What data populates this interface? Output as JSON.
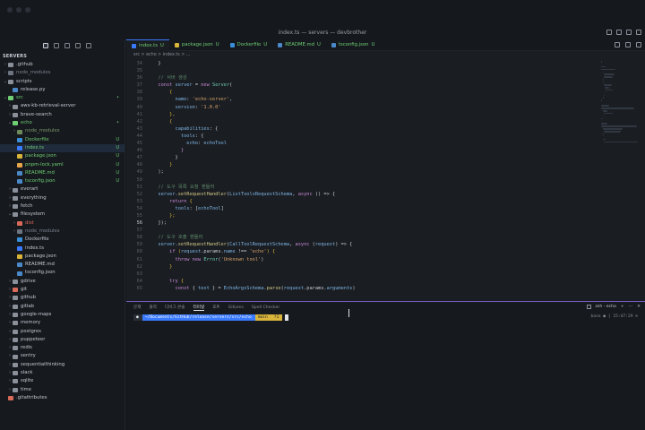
{
  "window": {
    "title": "index.ts — servers — devbrother"
  },
  "sidebar": {
    "title": "SERVERS",
    "items": [
      {
        "label": ".github",
        "indent": 1,
        "type": "folder",
        "open": false,
        "color": "#c6cbd3",
        "icon_color": "#8a9099"
      },
      {
        "label": "node_modules",
        "indent": 1,
        "type": "folder",
        "open": false,
        "color": "#7d8590",
        "icon_color": "#6d7580"
      },
      {
        "label": "scripts",
        "indent": 1,
        "type": "folder",
        "open": true,
        "color": "#c6cbd3",
        "icon_color": "#8a9099"
      },
      {
        "label": "release.py",
        "indent": 2,
        "type": "file",
        "color": "#c6cbd3",
        "icon_color": "#4a88c7"
      },
      {
        "label": "src",
        "indent": 1,
        "type": "folder",
        "open": true,
        "color": "#6fcf73",
        "icon_color": "#6fcf73",
        "badge": "•",
        "badge_color": "#6fcf73"
      },
      {
        "label": "aws-kb-retrieval-server",
        "indent": 2,
        "type": "folder",
        "open": false,
        "color": "#c6cbd3",
        "icon_color": "#8a9099"
      },
      {
        "label": "brave-search",
        "indent": 2,
        "type": "folder",
        "open": false,
        "color": "#c6cbd3",
        "icon_color": "#8a9099"
      },
      {
        "label": "echo",
        "indent": 2,
        "type": "folder",
        "open": true,
        "color": "#6fcf73",
        "icon_color": "#6fcf73",
        "badge": "•",
        "badge_color": "#6fcf73"
      },
      {
        "label": "node_modules",
        "indent": 3,
        "type": "folder",
        "open": false,
        "color": "#7d9a6a",
        "icon_color": "#6d8a5a"
      },
      {
        "label": "Dockerfile",
        "indent": 3,
        "type": "file",
        "color": "#6fcf73",
        "icon_color": "#3a8fd9",
        "badge": "U",
        "badge_color": "#6fcf73"
      },
      {
        "label": "index.ts",
        "indent": 3,
        "type": "file",
        "color": "#6fcf73",
        "icon_color": "#3a7afe",
        "badge": "U",
        "badge_color": "#6fcf73",
        "selected": true
      },
      {
        "label": "package.json",
        "indent": 3,
        "type": "file",
        "color": "#6fcf73",
        "icon_color": "#d9b43a",
        "badge": "U",
        "badge_color": "#6fcf73"
      },
      {
        "label": "pnpm-lock.yaml",
        "indent": 3,
        "type": "file",
        "color": "#6fcf73",
        "icon_color": "#e5a54a",
        "badge": "U",
        "badge_color": "#6fcf73"
      },
      {
        "label": "README.md",
        "indent": 3,
        "type": "file",
        "color": "#6fcf73",
        "icon_color": "#4a88c7",
        "badge": "U",
        "badge_color": "#6fcf73"
      },
      {
        "label": "tsconfig.json",
        "indent": 3,
        "type": "file",
        "color": "#6fcf73",
        "icon_color": "#4a88c7",
        "badge": "U",
        "badge_color": "#6fcf73"
      },
      {
        "label": "everart",
        "indent": 2,
        "type": "folder",
        "open": false,
        "color": "#c6cbd3",
        "icon_color": "#8a9099"
      },
      {
        "label": "everything",
        "indent": 2,
        "type": "folder",
        "open": false,
        "color": "#c6cbd3",
        "icon_color": "#8a9099"
      },
      {
        "label": "fetch",
        "indent": 2,
        "type": "folder",
        "open": false,
        "color": "#c6cbd3",
        "icon_color": "#8a9099"
      },
      {
        "label": "filesystem",
        "indent": 2,
        "type": "folder",
        "open": true,
        "color": "#c6cbd3",
        "icon_color": "#8a9099"
      },
      {
        "label": "dist",
        "indent": 3,
        "type": "folder",
        "open": false,
        "color": "#d96a5a",
        "icon_color": "#d96a5a"
      },
      {
        "label": "node_modules",
        "indent": 3,
        "type": "folder",
        "open": false,
        "color": "#7d8590",
        "icon_color": "#6d7580"
      },
      {
        "label": "Dockerfile",
        "indent": 3,
        "type": "file",
        "color": "#c6cbd3",
        "icon_color": "#3a8fd9"
      },
      {
        "label": "index.ts",
        "indent": 3,
        "type": "file",
        "color": "#c6cbd3",
        "icon_color": "#3a7afe"
      },
      {
        "label": "package.json",
        "indent": 3,
        "type": "file",
        "color": "#c6cbd3",
        "icon_color": "#d9b43a"
      },
      {
        "label": "README.md",
        "indent": 3,
        "type": "file",
        "color": "#c6cbd3",
        "icon_color": "#4a88c7"
      },
      {
        "label": "tsconfig.json",
        "indent": 3,
        "type": "file",
        "color": "#c6cbd3",
        "icon_color": "#4a88c7"
      },
      {
        "label": "gdrive",
        "indent": 2,
        "type": "folder",
        "open": false,
        "color": "#c6cbd3",
        "icon_color": "#8a9099"
      },
      {
        "label": "git",
        "indent": 2,
        "type": "folder",
        "open": false,
        "color": "#c6cbd3",
        "icon_color": "#d96a5a"
      },
      {
        "label": "github",
        "indent": 2,
        "type": "folder",
        "open": false,
        "color": "#c6cbd3",
        "icon_color": "#8a9099"
      },
      {
        "label": "gitlab",
        "indent": 2,
        "type": "folder",
        "open": false,
        "color": "#c6cbd3",
        "icon_color": "#8a9099"
      },
      {
        "label": "google-maps",
        "indent": 2,
        "type": "folder",
        "open": false,
        "color": "#c6cbd3",
        "icon_color": "#8a9099"
      },
      {
        "label": "memory",
        "indent": 2,
        "type": "folder",
        "open": false,
        "color": "#c6cbd3",
        "icon_color": "#8a9099"
      },
      {
        "label": "postgres",
        "indent": 2,
        "type": "folder",
        "open": false,
        "color": "#c6cbd3",
        "icon_color": "#8a9099"
      },
      {
        "label": "puppeteer",
        "indent": 2,
        "type": "folder",
        "open": false,
        "color": "#c6cbd3",
        "icon_color": "#8a9099"
      },
      {
        "label": "redis",
        "indent": 2,
        "type": "folder",
        "open": false,
        "color": "#c6cbd3",
        "icon_color": "#8a9099"
      },
      {
        "label": "sentry",
        "indent": 2,
        "type": "folder",
        "open": false,
        "color": "#c6cbd3",
        "icon_color": "#8a9099"
      },
      {
        "label": "sequentialthinking",
        "indent": 2,
        "type": "folder",
        "open": false,
        "color": "#c6cbd3",
        "icon_color": "#8a9099"
      },
      {
        "label": "slack",
        "indent": 2,
        "type": "folder",
        "open": false,
        "color": "#c6cbd3",
        "icon_color": "#8a9099"
      },
      {
        "label": "sqlite",
        "indent": 2,
        "type": "folder",
        "open": false,
        "color": "#c6cbd3",
        "icon_color": "#8a9099"
      },
      {
        "label": "time",
        "indent": 2,
        "type": "folder",
        "open": false,
        "color": "#c6cbd3",
        "icon_color": "#8a9099"
      },
      {
        "label": ".gitattributes",
        "indent": 1,
        "type": "file",
        "color": "#c6cbd3",
        "icon_color": "#d96a5a"
      }
    ]
  },
  "tabs": [
    {
      "label": "index.ts",
      "status": "U",
      "active": true,
      "icon_color": "#3a7afe"
    },
    {
      "label": "package.json",
      "status": "U",
      "active": false,
      "icon_color": "#d9b43a"
    },
    {
      "label": "Dockerfile",
      "status": "U",
      "active": false,
      "icon_color": "#3a8fd9"
    },
    {
      "label": "README.md",
      "status": "U",
      "active": false,
      "icon_color": "#4a88c7"
    },
    {
      "label": "tsconfig.json",
      "status": "U",
      "active": false,
      "icon_color": "#4a88c7"
    }
  ],
  "breadcrumb": "src > echo > index.ts > ...",
  "code": {
    "lines": [
      {
        "n": "34",
        "segs": [
          [
            "  }",
            "#c9ced6"
          ]
        ]
      },
      {
        "n": "35",
        "segs": [
          [
            "",
            "#c9ced6"
          ]
        ]
      },
      {
        "n": "36",
        "segs": [
          [
            "  // 서버 생성",
            "#5f8c6a"
          ]
        ]
      },
      {
        "n": "37",
        "segs": [
          [
            "  const ",
            "#c98bd9"
          ],
          [
            "server",
            "#7fb8e8"
          ],
          [
            " = ",
            "#c9ced6"
          ],
          [
            "new ",
            "#c98bd9"
          ],
          [
            "Server",
            "#6fcfb8"
          ],
          [
            "(",
            "#c9ced6"
          ]
        ]
      },
      {
        "n": "38",
        "segs": [
          [
            "      {",
            "#d9b43a"
          ]
        ]
      },
      {
        "n": "39",
        "segs": [
          [
            "        name",
            "#7fb8e8"
          ],
          [
            ": ",
            "#c9ced6"
          ],
          [
            "'echo-server'",
            "#d9a36a"
          ],
          [
            ",",
            "#c9ced6"
          ]
        ]
      },
      {
        "n": "40",
        "segs": [
          [
            "        version",
            "#7fb8e8"
          ],
          [
            ": ",
            "#c9ced6"
          ],
          [
            "'1.0.0'",
            "#d9a36a"
          ]
        ]
      },
      {
        "n": "41",
        "segs": [
          [
            "      },",
            "#d9b43a"
          ]
        ]
      },
      {
        "n": "42",
        "segs": [
          [
            "      {",
            "#d9b43a"
          ]
        ]
      },
      {
        "n": "43",
        "segs": [
          [
            "        capabilities",
            "#7fb8e8"
          ],
          [
            ": {",
            "#c9ced6"
          ]
        ]
      },
      {
        "n": "44",
        "segs": [
          [
            "          tools",
            "#7fb8e8"
          ],
          [
            ": {",
            "#c9ced6"
          ]
        ]
      },
      {
        "n": "45",
        "segs": [
          [
            "            echo",
            "#7fb8e8"
          ],
          [
            ": ",
            "#c9ced6"
          ],
          [
            "echoTool",
            "#7fb8e8"
          ]
        ]
      },
      {
        "n": "46",
        "segs": [
          [
            "          }",
            "#c98bd9"
          ]
        ]
      },
      {
        "n": "47",
        "segs": [
          [
            "        }",
            "#c9ced6"
          ]
        ]
      },
      {
        "n": "48",
        "segs": [
          [
            "      }",
            "#d9b43a"
          ]
        ]
      },
      {
        "n": "49",
        "segs": [
          [
            "  );",
            "#c9ced6"
          ]
        ]
      },
      {
        "n": "50",
        "segs": [
          [
            "",
            "#c9ced6"
          ]
        ]
      },
      {
        "n": "51",
        "segs": [
          [
            "  // 도구 목록 요청 핸들러",
            "#5f8c6a"
          ]
        ]
      },
      {
        "n": "52",
        "segs": [
          [
            "  server",
            "#7fb8e8"
          ],
          [
            ".",
            "#c9ced6"
          ],
          [
            "setRequestHandler",
            "#d9cf8a"
          ],
          [
            "(",
            "#c9ced6"
          ],
          [
            "ListToolsRequestSchema",
            "#7fb8e8"
          ],
          [
            ", ",
            "#c9ced6"
          ],
          [
            "async ",
            "#c98bd9"
          ],
          [
            "() => {",
            "#c9ced6"
          ]
        ]
      },
      {
        "n": "53",
        "segs": [
          [
            "      return ",
            "#c98bd9"
          ],
          [
            "{",
            "#d9b43a"
          ]
        ]
      },
      {
        "n": "54",
        "segs": [
          [
            "        tools",
            "#7fb8e8"
          ],
          [
            ": [",
            "#c9ced6"
          ],
          [
            "echoTool",
            "#7fb8e8"
          ],
          [
            "]",
            "#c9ced6"
          ]
        ]
      },
      {
        "n": "55",
        "segs": [
          [
            "      };",
            "#d9b43a"
          ]
        ]
      },
      {
        "n": "56",
        "segs": [
          [
            "  });",
            "#c9ced6"
          ]
        ],
        "current": true
      },
      {
        "n": "57",
        "segs": [
          [
            "",
            "#c9ced6"
          ]
        ]
      },
      {
        "n": "58",
        "segs": [
          [
            "  // 도구 호출 핸들러",
            "#5f8c6a"
          ]
        ]
      },
      {
        "n": "59",
        "segs": [
          [
            "  server",
            "#7fb8e8"
          ],
          [
            ".",
            "#c9ced6"
          ],
          [
            "setRequestHandler",
            "#d9cf8a"
          ],
          [
            "(",
            "#c9ced6"
          ],
          [
            "CallToolRequestSchema",
            "#7fb8e8"
          ],
          [
            ", ",
            "#c9ced6"
          ],
          [
            "async ",
            "#c98bd9"
          ],
          [
            "(",
            "#c9ced6"
          ],
          [
            "request",
            "#7fb8e8"
          ],
          [
            ") => {",
            "#c9ced6"
          ]
        ]
      },
      {
        "n": "60",
        "segs": [
          [
            "      if ",
            "#c98bd9"
          ],
          [
            "(",
            "#d9b43a"
          ],
          [
            "request",
            "#7fb8e8"
          ],
          [
            ".params.",
            "#c9ced6"
          ],
          [
            "name",
            "#7fb8e8"
          ],
          [
            " !== ",
            "#c9ced6"
          ],
          [
            "'echo'",
            "#d9a36a"
          ],
          [
            ") {",
            "#d9b43a"
          ]
        ]
      },
      {
        "n": "61",
        "segs": [
          [
            "        throw ",
            "#c98bd9"
          ],
          [
            "new ",
            "#c98bd9"
          ],
          [
            "Error",
            "#6fcfb8"
          ],
          [
            "(",
            "#c9ced6"
          ],
          [
            "'Unknown tool'",
            "#d9a36a"
          ],
          [
            ")",
            "#c9ced6"
          ]
        ]
      },
      {
        "n": "62",
        "segs": [
          [
            "      }",
            "#d9b43a"
          ]
        ]
      },
      {
        "n": "63",
        "segs": [
          [
            "",
            "#c9ced6"
          ]
        ]
      },
      {
        "n": "64",
        "segs": [
          [
            "      try ",
            "#c98bd9"
          ],
          [
            "{",
            "#d9b43a"
          ]
        ]
      },
      {
        "n": "65",
        "segs": [
          [
            "        const ",
            "#c98bd9"
          ],
          [
            "{ ",
            "#c9ced6"
          ],
          [
            "text",
            "#7fb8e8"
          ],
          [
            " } = ",
            "#c9ced6"
          ],
          [
            "EchoArgsSchema",
            "#7fb8e8"
          ],
          [
            ".",
            "#c9ced6"
          ],
          [
            "parse",
            "#d9cf8a"
          ],
          [
            "(",
            "#c9ced6"
          ],
          [
            "request",
            "#7fb8e8"
          ],
          [
            ".params.",
            "#c9ced6"
          ],
          [
            "arguments",
            "#7fb8e8"
          ],
          [
            ")",
            "#c9ced6"
          ]
        ]
      }
    ]
  },
  "panel": {
    "tabs": [
      "문제",
      "출력",
      "디버그 콘솔",
      "터미널",
      "포트",
      "GitLens",
      "Spell Checker"
    ],
    "active_tab": 3,
    "terminal_name": "zsh - echo",
    "prompt": {
      "user": "~/Documents/GitHub/release/servers/src/echo",
      "branch": "main",
      "status": "?1"
    },
    "right_info": "base ● | 15:47:29 ⊙"
  },
  "colors": {
    "accent": "#3a7afe",
    "added": "#6fcf73",
    "panel_border": "#7a5cc0"
  }
}
